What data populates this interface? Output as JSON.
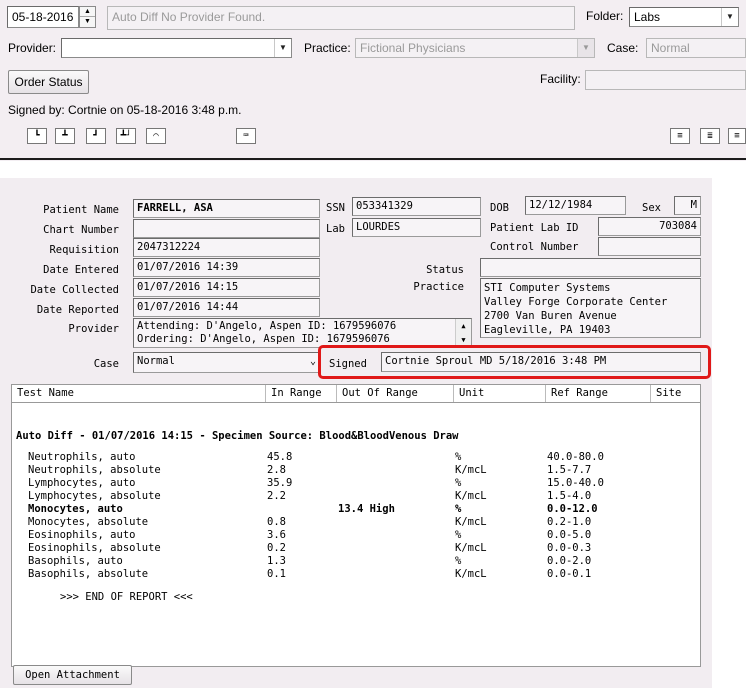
{
  "header": {
    "date": "05-18-2016",
    "message": "Auto Diff No Provider Found.",
    "folder_label": "Folder:",
    "folder_value": "Labs",
    "provider_label": "Provider:",
    "provider_value": "",
    "practice_label": "Practice:",
    "practice_value": "Fictional Physicians",
    "case_label": "Case:",
    "case_value": "Normal",
    "order_status_label": "Order Status",
    "facility_label": "Facility:",
    "facility_value": "",
    "signed_by": "Signed by: Cortnie on 05-18-2016  3:48 p.m."
  },
  "report": {
    "labels": {
      "patient_name": "Patient Name",
      "chart_number": "Chart Number",
      "requisition": "Requisition",
      "date_entered": "Date Entered",
      "date_collected": "Date Collected",
      "date_reported": "Date Reported",
      "provider": "Provider",
      "case": "Case",
      "ssn": "SSN",
      "lab": "Lab",
      "dob": "DOB",
      "sex": "Sex",
      "patient_lab_id": "Patient Lab ID",
      "control_number": "Control Number",
      "status": "Status",
      "practice": "Practice",
      "signed": "Signed"
    },
    "values": {
      "patient_name": "FARRELL, ASA",
      "chart_number": "",
      "requisition": "2047312224",
      "date_entered": "01/07/2016 14:39",
      "date_collected": "01/07/2016 14:15",
      "date_reported": "01/07/2016 14:44",
      "attending": "Attending:  D'Angelo, Aspen  ID: 1679596076",
      "ordering": "Ordering:   D'Angelo, Aspen  ID: 1679596076",
      "case": "Normal",
      "ssn": "053341329",
      "lab": "LOURDES",
      "dob": "12/12/1984",
      "sex": "M",
      "patient_lab_id": "703084",
      "control_number": "",
      "status": "",
      "practice_line1": "STI Computer Systems",
      "practice_line2": "Valley Forge Corporate Center",
      "practice_line3": "2700 Van Buren Avenue",
      "practice_line4": "Eagleville, PA 19403",
      "signed": "Cortnie Sproul MD 5/18/2016 3:48 PM"
    },
    "columns": [
      "Test Name",
      "In Range",
      "Out Of Range",
      "Unit",
      "Ref Range",
      "Site"
    ],
    "section_title": "Auto Diff - 01/07/2016 14:15 - Specimen Source: Blood&BloodVenous Draw",
    "rows": [
      {
        "name": "Neutrophils, auto",
        "in_range": "45.8",
        "out_range": "",
        "unit": "%",
        "ref": "40.0-80.0",
        "bold": false
      },
      {
        "name": "Neutrophils, absolute",
        "in_range": "2.8",
        "out_range": "",
        "unit": "K/mcL",
        "ref": "1.5-7.7",
        "bold": false
      },
      {
        "name": "Lymphocytes, auto",
        "in_range": "35.9",
        "out_range": "",
        "unit": "%",
        "ref": "15.0-40.0",
        "bold": false
      },
      {
        "name": "Lymphocytes, absolute",
        "in_range": "2.2",
        "out_range": "",
        "unit": "K/mcL",
        "ref": "1.5-4.0",
        "bold": false
      },
      {
        "name": "Monocytes, auto",
        "in_range": "",
        "out_range": "13.4 High",
        "unit": "%",
        "ref": "0.0-12.0",
        "bold": true
      },
      {
        "name": "Monocytes, absolute",
        "in_range": "0.8",
        "out_range": "",
        "unit": "K/mcL",
        "ref": "0.2-1.0",
        "bold": false
      },
      {
        "name": "Eosinophils, auto",
        "in_range": "3.6",
        "out_range": "",
        "unit": "%",
        "ref": "0.0-5.0",
        "bold": false
      },
      {
        "name": "Eosinophils, absolute",
        "in_range": "0.2",
        "out_range": "",
        "unit": "K/mcL",
        "ref": "0.0-0.3",
        "bold": false
      },
      {
        "name": "Basophils, auto",
        "in_range": "1.3",
        "out_range": "",
        "unit": "%",
        "ref": "0.0-2.0",
        "bold": false
      },
      {
        "name": "Basophils, absolute",
        "in_range": "0.1",
        "out_range": "",
        "unit": "K/mcL",
        "ref": "0.0-0.1",
        "bold": false
      }
    ],
    "end_text": ">>> END OF REPORT <<<",
    "open_attachment_label": "Open Attachment"
  },
  "colors": {
    "highlight_border": "#e01818",
    "panel_bg": "#f3eef2"
  }
}
